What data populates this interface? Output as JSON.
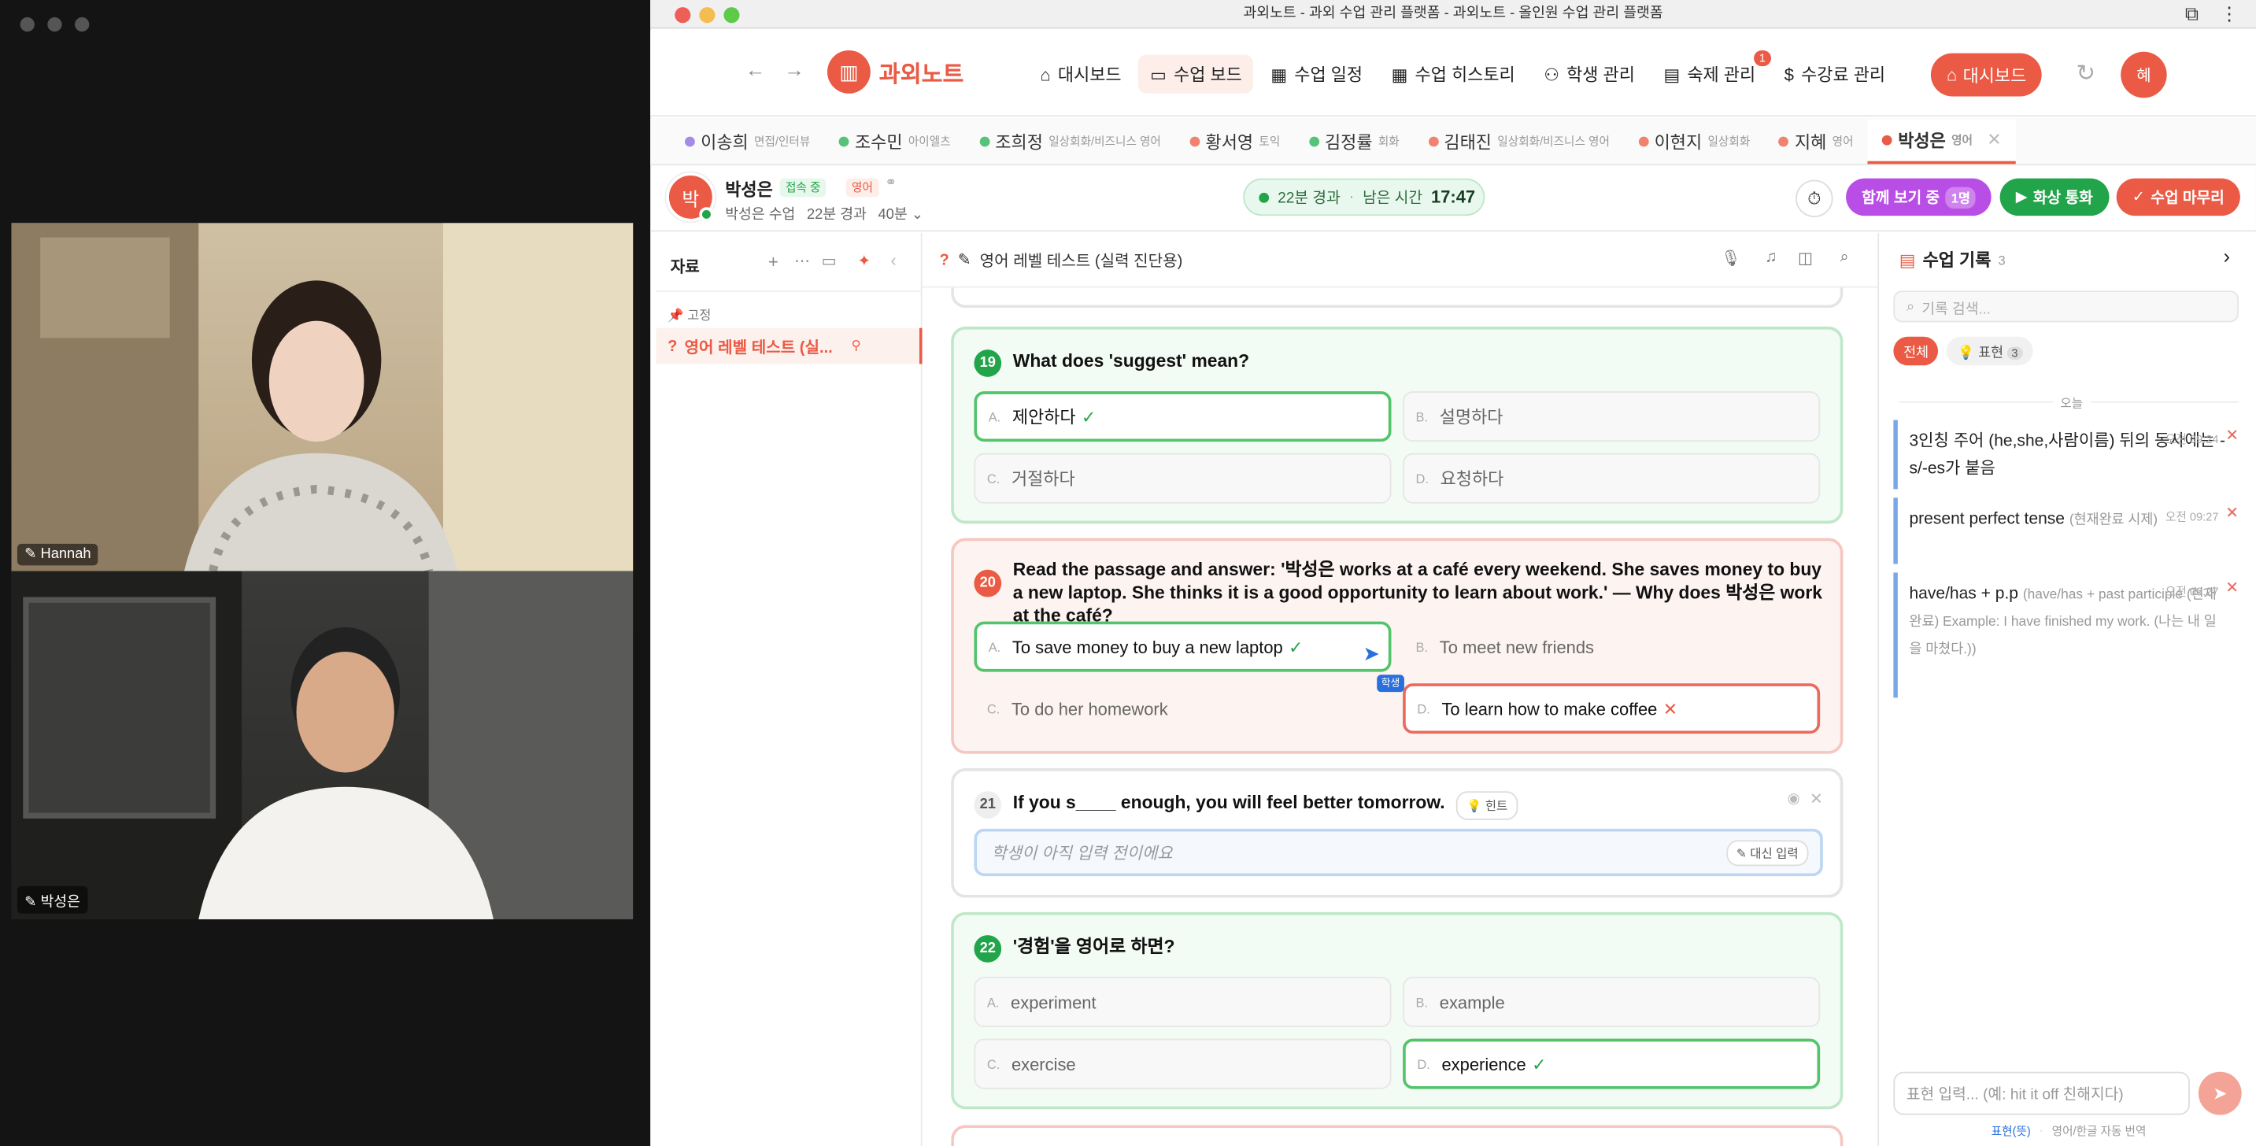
{
  "video_call": {
    "participants": [
      {
        "name": "Hannah"
      },
      {
        "name": "박성은"
      }
    ]
  },
  "window": {
    "title": "과외노트 - 과외 수업 관리 플랫폼 - 과외노트 - 올인원 수업 관리 플랫폼"
  },
  "nav": {
    "logo": "과외노트",
    "items": [
      {
        "label": "대시보드",
        "icon": "home-icon"
      },
      {
        "label": "수업 보드",
        "icon": "monitor-icon",
        "active": true
      },
      {
        "label": "수업 일정",
        "icon": "calendar-icon"
      },
      {
        "label": "수업 히스토리",
        "icon": "calendar-icon"
      },
      {
        "label": "학생 관리",
        "icon": "users-icon"
      },
      {
        "label": "숙제 관리",
        "icon": "document-icon",
        "badge": "1"
      },
      {
        "label": "수강료 관리",
        "icon": "dollar-icon"
      }
    ],
    "dashboard_button": "대시보드",
    "avatar": "혜"
  },
  "student_tabs": [
    {
      "name": "이송희",
      "sub": "면접/인터뷰",
      "color": "#a58ae8"
    },
    {
      "name": "조수민",
      "sub": "아이엘츠",
      "color": "#56c27a"
    },
    {
      "name": "조희정",
      "sub": "일상회화/비즈니스 영어",
      "color": "#56c27a"
    },
    {
      "name": "황서영",
      "sub": "토익",
      "color": "#f0826f"
    },
    {
      "name": "김정률",
      "sub": "회화",
      "color": "#56c27a"
    },
    {
      "name": "김태진",
      "sub": "일상회화/비즈니스 영어",
      "color": "#f0826f"
    },
    {
      "name": "이현지",
      "sub": "일상회화",
      "color": "#f0826f"
    },
    {
      "name": "지혜",
      "sub": "영어",
      "color": "#f0826f"
    },
    {
      "name": "박성은",
      "sub": "영어",
      "color": "#ea5a44",
      "active": true
    }
  ],
  "student": {
    "avatar": "박",
    "name": "박성은",
    "status": "접속 중",
    "subject": "영어",
    "lesson": "박성은 수업",
    "elapsed": "22분 경과",
    "duration": "40분"
  },
  "timer": {
    "elapsed": "22분 경과",
    "remaining_label": "남은 시간",
    "remaining": "17:47"
  },
  "actions": {
    "watching": "함께 보기 중",
    "watching_count": "1명",
    "video_call": "화상 통화",
    "finish": "수업 마무리"
  },
  "sidebar": {
    "title": "자료",
    "pinned_label": "고정",
    "items": [
      {
        "label": "영어 레벨 테스트 (실..."
      }
    ]
  },
  "document": {
    "title": "영어 레벨 테스트 (실력 진단용)"
  },
  "questions": [
    {
      "num": "19",
      "text": "What does 'suggest' mean?",
      "options": [
        {
          "letter": "A.",
          "text": "제안하다",
          "state": "correct"
        },
        {
          "letter": "B.",
          "text": "설명하다"
        },
        {
          "letter": "C.",
          "text": "거절하다"
        },
        {
          "letter": "D.",
          "text": "요청하다"
        }
      ]
    },
    {
      "num": "20",
      "text": "Read the passage and answer: '박성은 works at a café every weekend. She saves money to buy a new laptop. She thinks it is a good opportunity to learn about work.' — Why does 박성은 work at the café?",
      "options": [
        {
          "letter": "A.",
          "text": "To save money to buy a new laptop",
          "state": "correct"
        },
        {
          "letter": "B.",
          "text": "To meet new friends"
        },
        {
          "letter": "C.",
          "text": "To do her homework"
        },
        {
          "letter": "D.",
          "text": "To learn how to make coffee",
          "state": "wrong"
        }
      ],
      "student_tag": "학생"
    },
    {
      "num": "21",
      "text": "If you s____ enough, you will feel better tomorrow.",
      "hint": "힌트",
      "placeholder": "학생이 아직 입력 전이에요",
      "proxy": "대신 입력"
    },
    {
      "num": "22",
      "text": "'경험'을 영어로 하면?",
      "options": [
        {
          "letter": "A.",
          "text": "experiment"
        },
        {
          "letter": "B.",
          "text": "example"
        },
        {
          "letter": "C.",
          "text": "exercise"
        },
        {
          "letter": "D.",
          "text": "experience",
          "state": "correct"
        }
      ]
    }
  ],
  "records": {
    "title": "수업 기록",
    "count": "3",
    "search_placeholder": "기록 검색...",
    "filters": [
      {
        "label": "전체"
      },
      {
        "label": "표현",
        "count": "3"
      }
    ],
    "date": "오늘",
    "items": [
      {
        "text": "3인칭 주어 (he,she,사람이름) 뒤의 동사에는 -s/-es가 붙음",
        "note": "",
        "time": "오전 09:24"
      },
      {
        "text": "present perfect tense",
        "note": "(현재완료 시제)",
        "time": "오전 09:27"
      },
      {
        "text": "have/has + p.p",
        "note": "(have/has + past participle (현재완료) Example: I have finished my work. (나는 내 일을 마쳤다.))",
        "time": "오전 09:27"
      }
    ],
    "input_placeholder": "표현 입력... (예: hit it off 친해지다)",
    "footer_mode": "표현(뜻)",
    "footer_translate": "영어/한글 자동 번역"
  },
  "colors": {
    "accent": "#ea5a44",
    "green": "#22a54a",
    "purple": "#b94ee6"
  }
}
